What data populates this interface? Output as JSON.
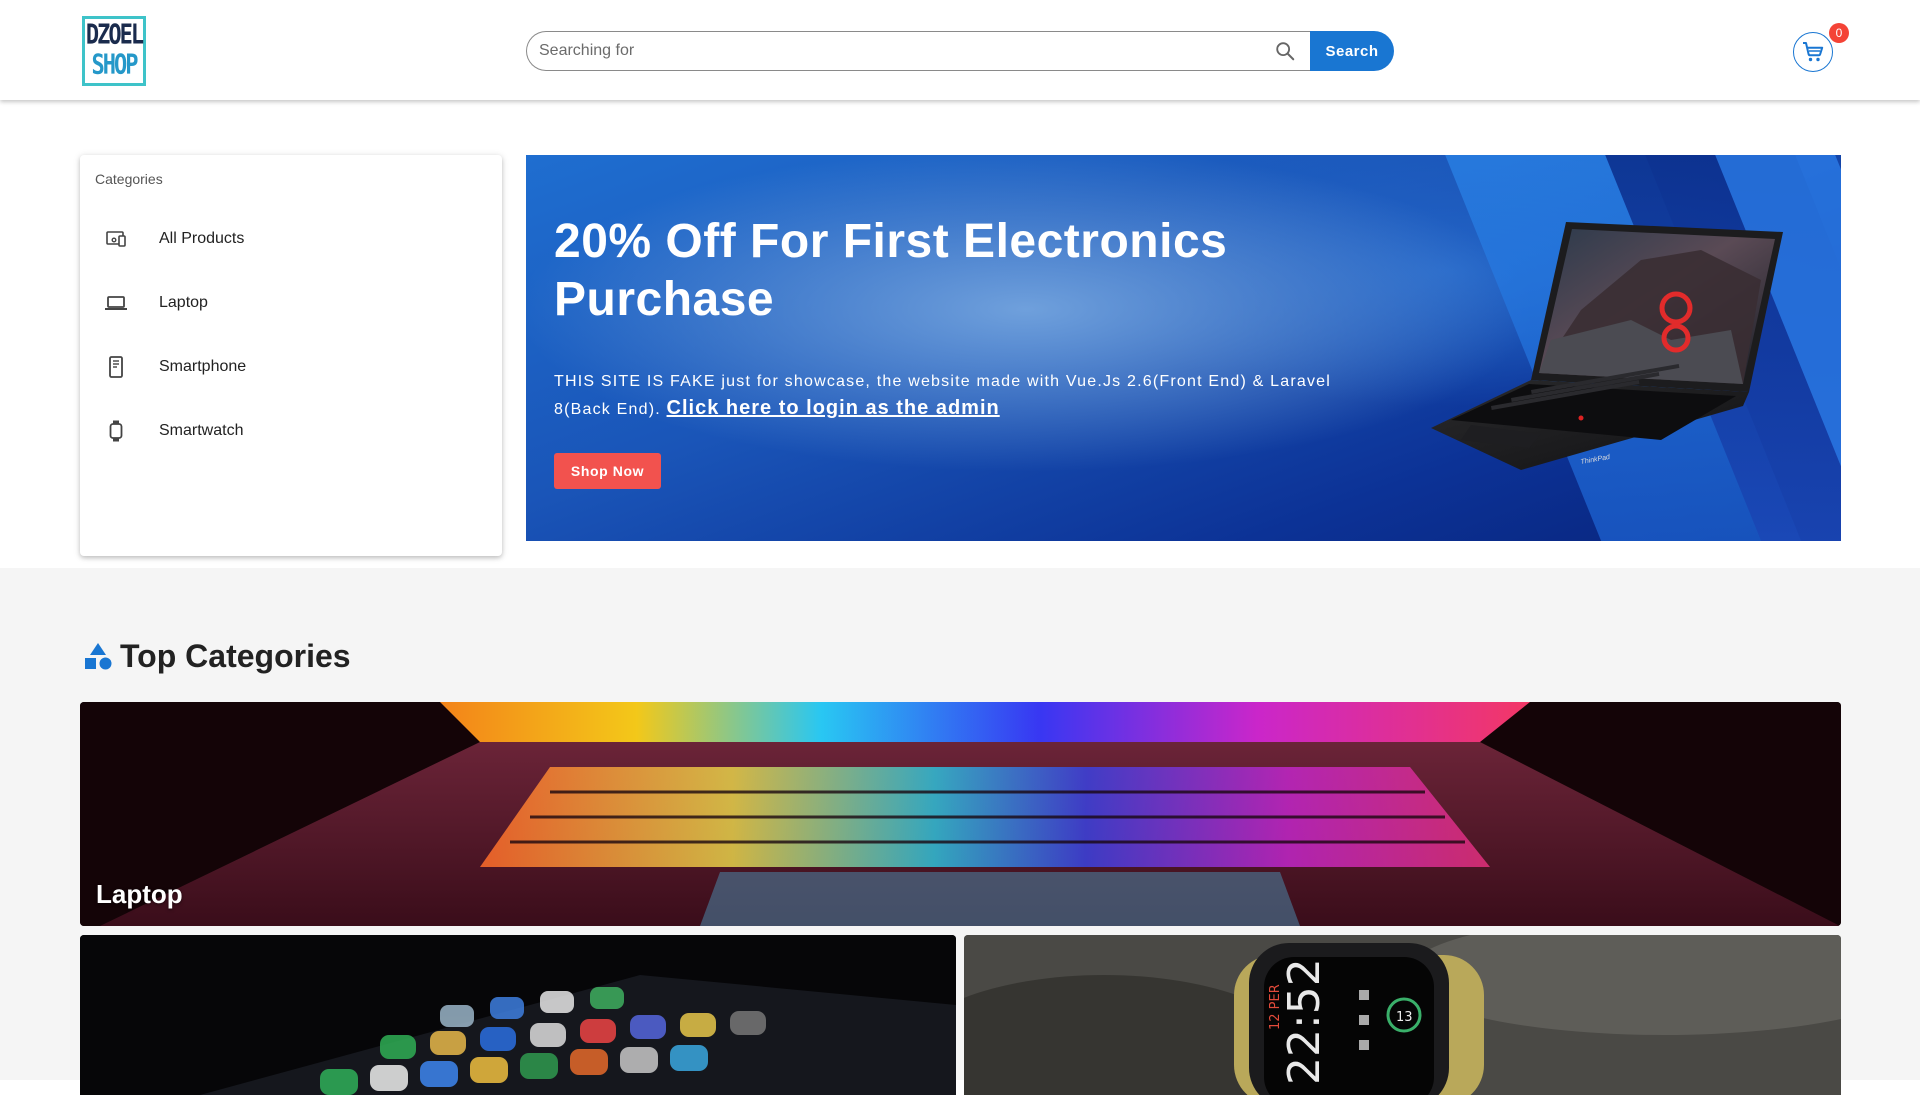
{
  "header": {
    "logo_line1": "DZOEL",
    "logo_line2": "SHOP",
    "search_placeholder": "Searching for",
    "search_button": "Search",
    "cart_count": "0"
  },
  "sidebar": {
    "title": "Categories",
    "items": [
      {
        "label": "All Products",
        "icon": "devices-icon"
      },
      {
        "label": "Laptop",
        "icon": "laptop-icon"
      },
      {
        "label": "Smartphone",
        "icon": "smartphone-icon"
      },
      {
        "label": "Smartwatch",
        "icon": "watch-icon"
      }
    ]
  },
  "hero": {
    "title": "20% Off For First Electronics Purchase",
    "description": "THIS SITE IS FAKE just for showcase, the website made with Vue.Js 2.6(Front End) & Laravel 8(Back End).",
    "link_text": "Click here to login as the admin",
    "button": "Shop Now",
    "laptop_brand": "ThinkPad"
  },
  "top_categories": {
    "title": "Top Categories",
    "icon": "shapes-icon",
    "cards": [
      {
        "label": "Laptop"
      },
      {
        "label": ""
      },
      {
        "label": ""
      }
    ]
  },
  "watch_face": {
    "time": "22:52",
    "date": "12 PER",
    "complication": "13"
  },
  "colors": {
    "primary": "#1976d2",
    "accent_red": "#f2524e",
    "badge_red": "#f44336",
    "section_bg": "#f5f5f5"
  }
}
